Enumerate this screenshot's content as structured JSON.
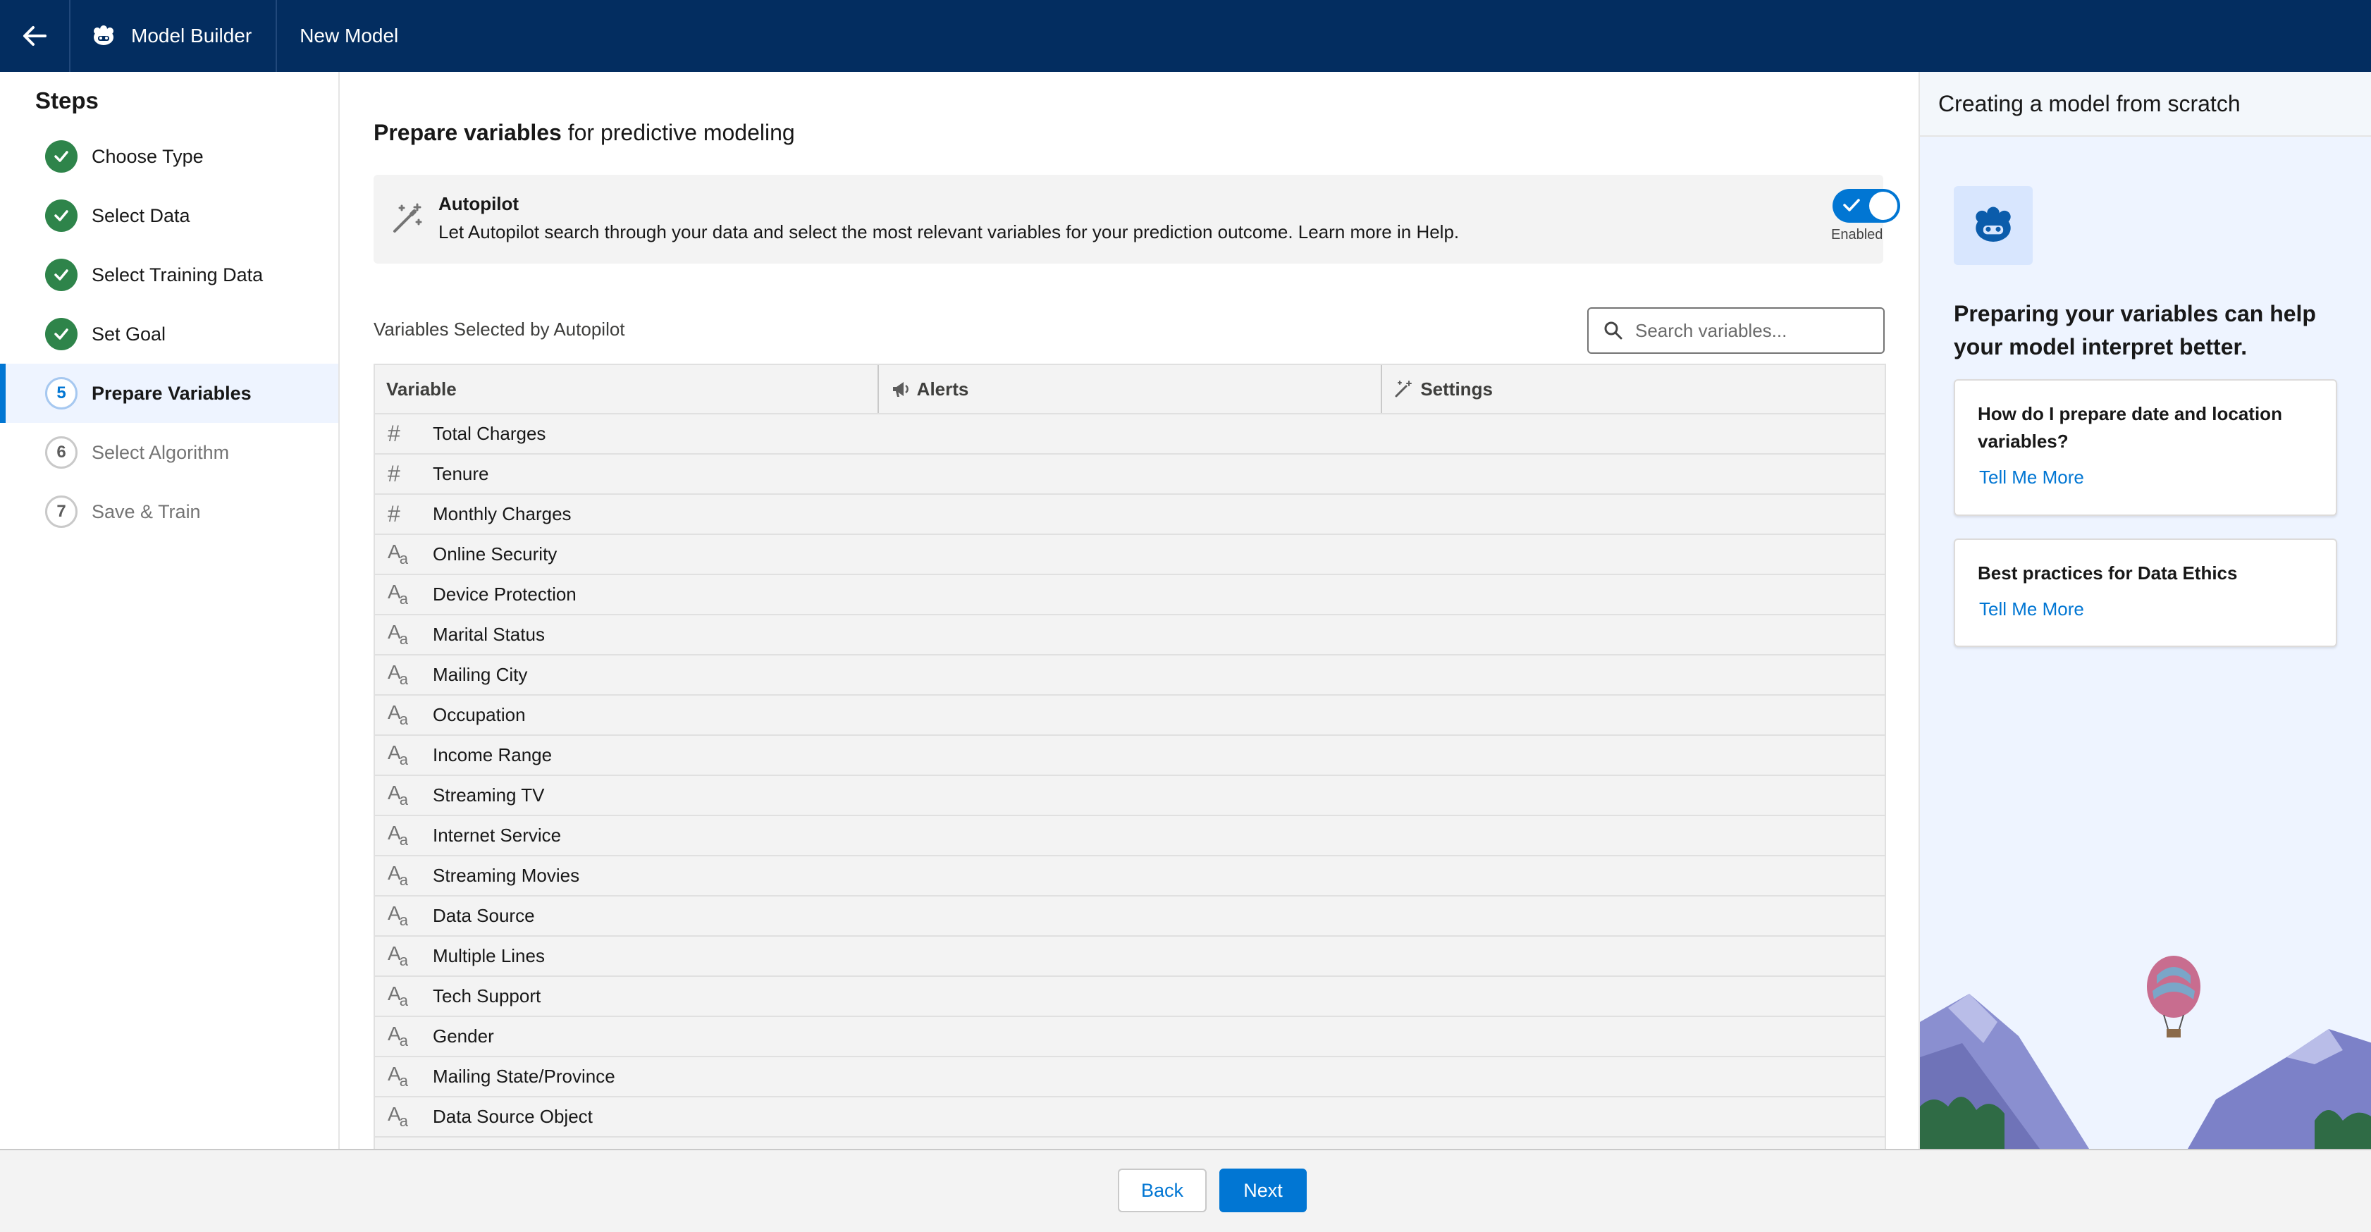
{
  "header": {
    "app_name": "Model Builder",
    "tab_label": "New Model",
    "bg_color": "#032d60"
  },
  "steps": {
    "title": "Steps",
    "items": [
      {
        "number": "1",
        "label": "Choose Type",
        "status": "done"
      },
      {
        "number": "2",
        "label": "Select Data",
        "status": "done"
      },
      {
        "number": "3",
        "label": "Select Training Data",
        "status": "done"
      },
      {
        "number": "4",
        "label": "Set Goal",
        "status": "done"
      },
      {
        "number": "5",
        "label": "Prepare Variables",
        "status": "current"
      },
      {
        "number": "6",
        "label": "Select Algorithm",
        "status": "todo"
      },
      {
        "number": "7",
        "label": "Save & Train",
        "status": "todo"
      }
    ]
  },
  "main": {
    "title_bold": "Prepare variables",
    "title_rest": " for predictive modeling",
    "autopilot": {
      "title": "Autopilot",
      "description": "Let Autopilot search through your data and select the most relevant variables for your prediction outcome. Learn more in Help.",
      "toggle_label": "Enabled",
      "enabled": true
    },
    "variables_label": "Variables Selected by Autopilot",
    "search_placeholder": "Search variables...",
    "columns": [
      "Variable",
      "Alerts",
      "Settings"
    ],
    "rows": [
      {
        "type": "number",
        "name": "Total Charges"
      },
      {
        "type": "number",
        "name": "Tenure"
      },
      {
        "type": "number",
        "name": "Monthly Charges"
      },
      {
        "type": "text",
        "name": "Online Security"
      },
      {
        "type": "text",
        "name": "Device Protection"
      },
      {
        "type": "text",
        "name": "Marital Status"
      },
      {
        "type": "text",
        "name": "Mailing City"
      },
      {
        "type": "text",
        "name": "Occupation"
      },
      {
        "type": "text",
        "name": "Income Range"
      },
      {
        "type": "text",
        "name": "Streaming TV"
      },
      {
        "type": "text",
        "name": "Internet Service"
      },
      {
        "type": "text",
        "name": "Streaming Movies"
      },
      {
        "type": "text",
        "name": "Data Source"
      },
      {
        "type": "text",
        "name": "Multiple Lines"
      },
      {
        "type": "text",
        "name": "Tech Support"
      },
      {
        "type": "text",
        "name": "Gender"
      },
      {
        "type": "text",
        "name": "Mailing State/Province"
      },
      {
        "type": "text",
        "name": "Data Source Object"
      }
    ]
  },
  "help": {
    "header": "Creating a model from scratch",
    "heading": "Preparing your variables can help your model interpret better.",
    "cards": [
      {
        "question": "How do I prepare date and location variables?",
        "link": "Tell Me More"
      },
      {
        "question": "Best practices for Data Ethics",
        "link": "Tell Me More"
      }
    ]
  },
  "footer": {
    "back_label": "Back",
    "next_label": "Next"
  }
}
